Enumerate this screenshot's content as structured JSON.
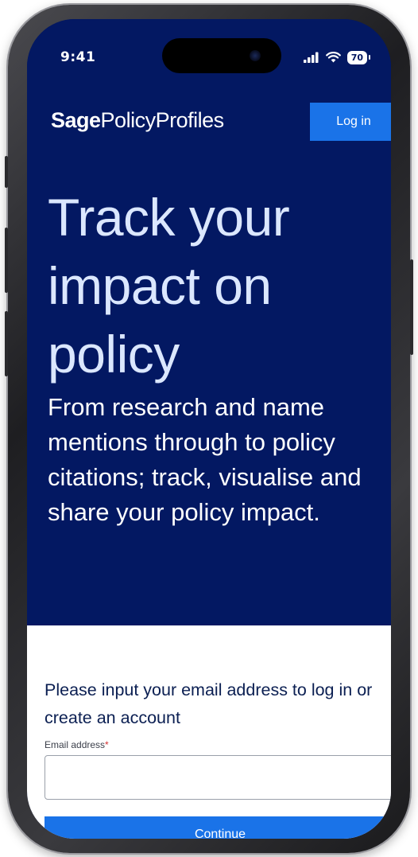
{
  "status_bar": {
    "time": "9:41",
    "battery": "70",
    "signal_icon": "cellular-signal-icon",
    "wifi_icon": "wifi-icon"
  },
  "header": {
    "logo_bold": "Sage",
    "logo_rest": "PolicyProfiles",
    "login_label": "Log in"
  },
  "hero": {
    "headline": "Track your impact on policy",
    "subtext": "From research and name mentions through to policy citations; track, visualise and share your policy impact."
  },
  "form": {
    "title": "Please input your email address to log in or create an account",
    "email_label": "Email address",
    "required_marker": "*",
    "email_value": "",
    "continue_label": "Continue"
  },
  "colors": {
    "hero_bg": "#031862",
    "accent": "#1a73e8",
    "form_title": "#0b1f52"
  }
}
